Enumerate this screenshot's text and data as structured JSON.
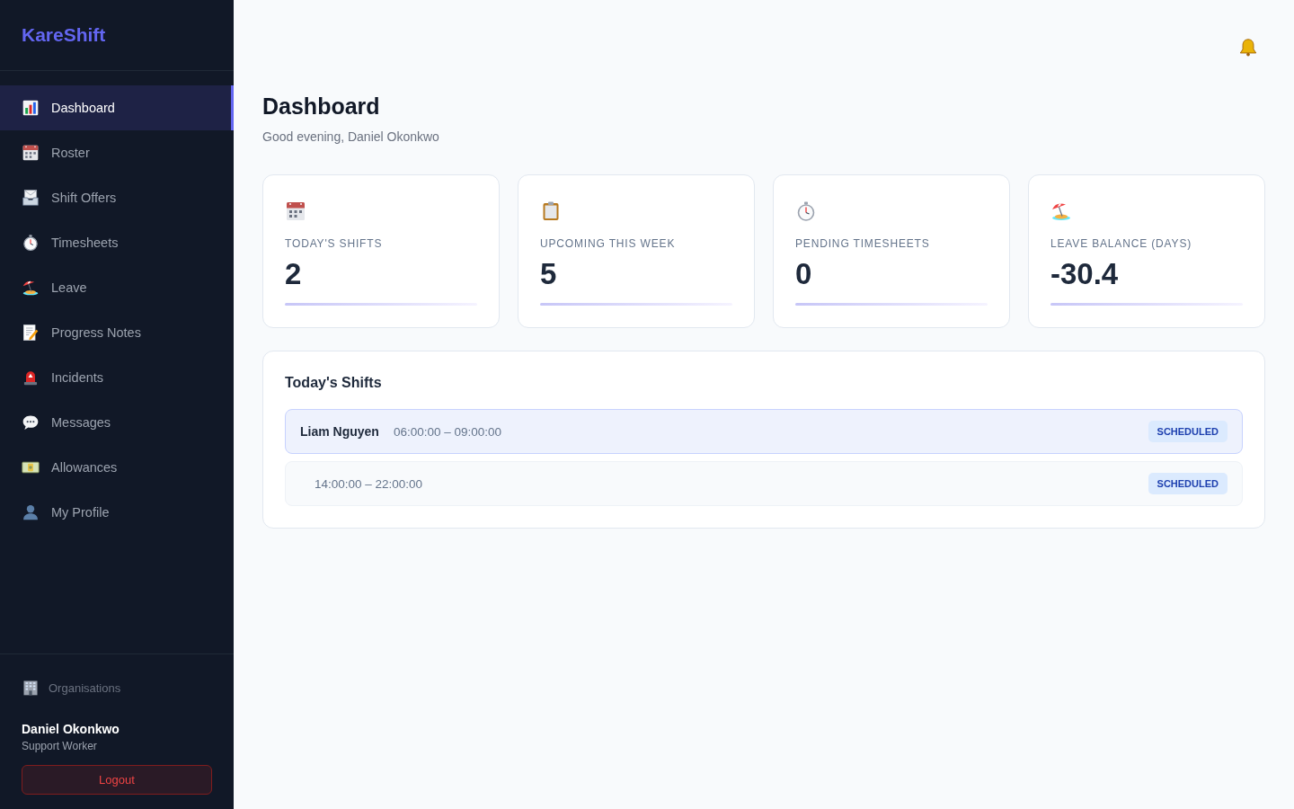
{
  "sidebar": {
    "brand": "KareShift",
    "nav_items": [
      {
        "label": "Dashboard",
        "selected": true
      },
      {
        "label": "Roster",
        "selected": false
      },
      {
        "label": "Shift Offers",
        "selected": false
      },
      {
        "label": "Timesheets",
        "selected": false
      },
      {
        "label": "Leave",
        "selected": false
      },
      {
        "label": "Progress Notes",
        "selected": false
      },
      {
        "label": "Incidents",
        "selected": false
      },
      {
        "label": "Messages",
        "selected": false
      },
      {
        "label": "Allowances",
        "selected": false
      },
      {
        "label": "My Profile",
        "selected": false
      }
    ],
    "organisations_link": "Organisations",
    "user": {
      "name": "Daniel Okonkwo",
      "role": "Support Worker"
    },
    "logout_button": "Logout"
  },
  "header": {
    "title": "Dashboard",
    "greeting": "Good evening, Daniel Okonkwo"
  },
  "stat_cards": [
    {
      "label": "TODAY'S SHIFTS",
      "value": "2"
    },
    {
      "label": "UPCOMING THIS WEEK",
      "value": "5"
    },
    {
      "label": "PENDING TIMESHEETS",
      "value": "0"
    },
    {
      "label": "LEAVE BALANCE (DAYS)",
      "value": "-30.4"
    }
  ],
  "todays_shifts": {
    "title": "Today's Shifts",
    "shifts": [
      {
        "worker": "Liam Nguyen",
        "time": "06:00:00 – 09:00:00",
        "status": "SCHEDULED",
        "highlighted": true
      },
      {
        "time": "14:00:00 – 22:00:00",
        "status": "SCHEDULED",
        "highlighted": false
      }
    ]
  }
}
